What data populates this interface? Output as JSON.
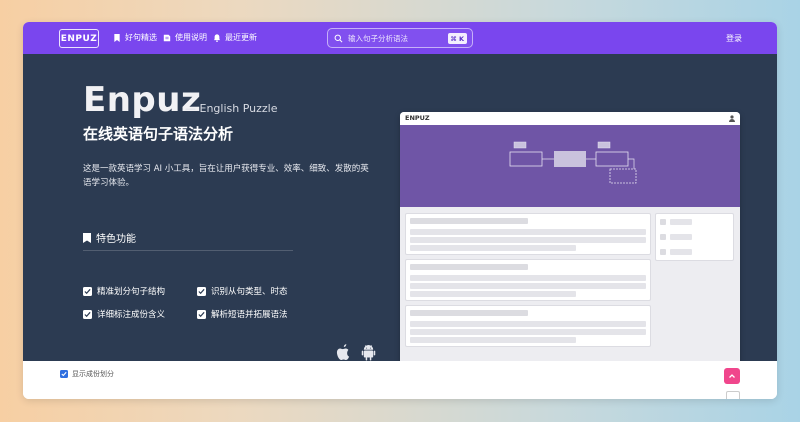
{
  "nav": {
    "logo": "ENPUZ",
    "items": [
      {
        "label": "好句精选",
        "icon": "bookmark-icon"
      },
      {
        "label": "使用说明",
        "icon": "book-icon"
      },
      {
        "label": "最近更新",
        "icon": "bell-icon"
      }
    ],
    "search_placeholder": "输入句子分析语法",
    "search_shortcut": "⌘ K",
    "login": "登录"
  },
  "hero": {
    "brand": "Enpuz",
    "brand_sub": "— English Puzzle",
    "tagline": "在线英语句子语法分析",
    "description": "这是一款英语学习 AI 小工具，旨在让用户获得专业、效率、细致、发散的英语学习体验。",
    "features_title": "特色功能",
    "features": [
      "精准划分句子结构",
      "识别从句类型、时态",
      "详细标注成份含义",
      "解析短语并拓展语法"
    ],
    "platforms": [
      "apple-icon",
      "android-icon"
    ]
  },
  "preview": {
    "title": "ENPUZ"
  },
  "bottom": {
    "toggle_label": "显示成份划分",
    "toggle_checked": true
  },
  "colors": {
    "nav": "#7a46ee",
    "hero": "#2c3b52",
    "accent_pink": "#f0468c",
    "checkbox_blue": "#2f6fe0"
  }
}
